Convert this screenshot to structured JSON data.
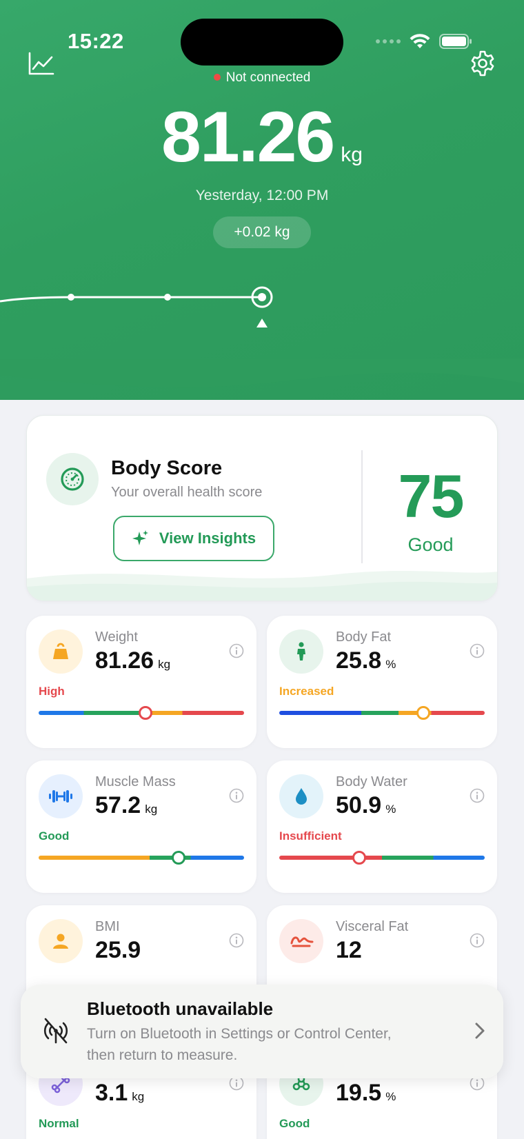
{
  "status_bar": {
    "time": "15:22"
  },
  "header": {
    "connection_status": "Not connected",
    "weight_value": "81.26",
    "weight_unit": "kg",
    "measured_at": "Yesterday, 12:00 PM",
    "delta": "+0.02 kg"
  },
  "score": {
    "title": "Body Score",
    "subtitle": "Your overall health score",
    "insights_label": "View Insights",
    "value": "75",
    "rating": "Good"
  },
  "metrics": [
    {
      "name": "Weight",
      "value": "81.26",
      "unit": "kg",
      "status": "High",
      "status_color": "#e5484d",
      "icon_bg": "#fff3dc",
      "icon_color": "#f5a623",
      "icon": "weight-icon",
      "gauge_position": 0.52
    },
    {
      "name": "Body Fat",
      "value": "25.8",
      "unit": "%",
      "status": "Increased",
      "status_color": "#f5a623",
      "icon_bg": "#e7f4ec",
      "icon_color": "#239a57",
      "icon": "person-icon",
      "gauge_position": 0.7
    },
    {
      "name": "Muscle Mass",
      "value": "57.2",
      "unit": "kg",
      "status": "Good",
      "status_color": "#239a57",
      "icon_bg": "#e6f0fe",
      "icon_color": "#1f78e8",
      "icon": "dumbbell-icon",
      "gauge_position": 0.68
    },
    {
      "name": "Body Water",
      "value": "50.9",
      "unit": "%",
      "status": "Insufficient",
      "status_color": "#e5484d",
      "icon_bg": "#e3f3fa",
      "icon_color": "#1d8fc4",
      "icon": "water-drop-icon",
      "gauge_position": 0.39
    },
    {
      "name": "BMI",
      "value": "25.9",
      "unit": "",
      "status": "",
      "status_color": "#f5a623",
      "icon_bg": "#fff3dc",
      "icon_color": "#f5a623",
      "icon": "user-icon"
    },
    {
      "name": "Visceral Fat",
      "value": "12",
      "unit": "",
      "status": "",
      "status_color": "#f5a623",
      "icon_bg": "#fdebe8",
      "icon_color": "#e5533d",
      "icon": "visceral-icon"
    },
    {
      "name": "",
      "value": "3.1",
      "unit": "kg",
      "status": "Normal",
      "status_color": "#239a57",
      "icon_bg": "#eee9fb",
      "icon_color": "#7b61d9",
      "icon": "bone-icon"
    },
    {
      "name": "",
      "value": "19.5",
      "unit": "%",
      "status": "Good",
      "status_color": "#239a57",
      "icon_bg": "#e7f4ec",
      "icon_color": "#239a57",
      "icon": "protein-icon"
    }
  ],
  "bluetooth_banner": {
    "title": "Bluetooth unavailable",
    "message": "Turn on Bluetooth in Settings or Control Center, then return to measure."
  },
  "colors": {
    "brand_green": "#2f9e5f",
    "accent_green": "#239a57"
  }
}
